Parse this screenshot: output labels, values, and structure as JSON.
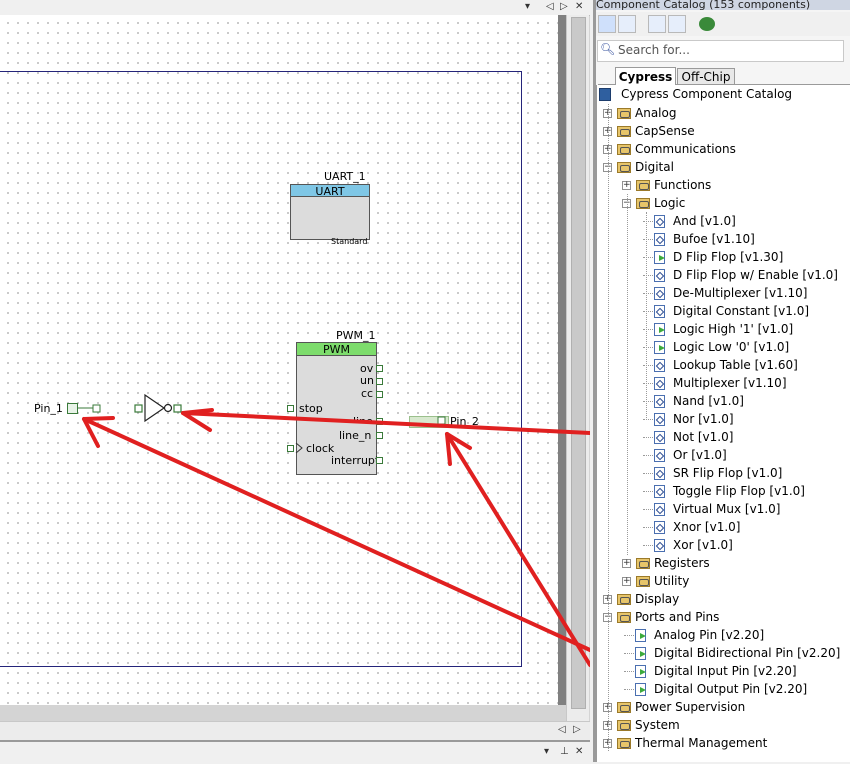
{
  "catalog": {
    "title": "Component Catalog (153 components)",
    "search_placeholder": "Search for...",
    "tabs": [
      {
        "label": "Cypress"
      },
      {
        "label": "Off-Chip"
      }
    ],
    "root_label": "Cypress Component Catalog",
    "tree": [
      {
        "label": "Analog",
        "depth": 0,
        "kind": "folder",
        "expander": "+"
      },
      {
        "label": "CapSense",
        "depth": 0,
        "kind": "folder",
        "expander": "+"
      },
      {
        "label": "Communications",
        "depth": 0,
        "kind": "folder",
        "expander": "+"
      },
      {
        "label": "Digital",
        "depth": 0,
        "kind": "folder",
        "expander": "-"
      },
      {
        "label": "Functions",
        "depth": 1,
        "kind": "folder",
        "expander": "+"
      },
      {
        "label": "Logic",
        "depth": 1,
        "kind": "folder",
        "expander": "-"
      },
      {
        "label": "And [v1.0]",
        "depth": 2,
        "kind": "leaf"
      },
      {
        "label": "Bufoe [v1.10]",
        "depth": 2,
        "kind": "leaf"
      },
      {
        "label": "D Flip Flop [v1.30]",
        "depth": 2,
        "kind": "leaf-green"
      },
      {
        "label": "D Flip Flop w/ Enable [v1.0]",
        "depth": 2,
        "kind": "leaf"
      },
      {
        "label": "De-Multiplexer [v1.10]",
        "depth": 2,
        "kind": "leaf"
      },
      {
        "label": "Digital Constant [v1.0]",
        "depth": 2,
        "kind": "leaf"
      },
      {
        "label": "Logic High '1' [v1.0]",
        "depth": 2,
        "kind": "leaf-green"
      },
      {
        "label": "Logic Low '0' [v1.0]",
        "depth": 2,
        "kind": "leaf-green"
      },
      {
        "label": "Lookup Table [v1.60]",
        "depth": 2,
        "kind": "leaf"
      },
      {
        "label": "Multiplexer [v1.10]",
        "depth": 2,
        "kind": "leaf"
      },
      {
        "label": "Nand [v1.0]",
        "depth": 2,
        "kind": "leaf"
      },
      {
        "label": "Nor [v1.0]",
        "depth": 2,
        "kind": "leaf"
      },
      {
        "label": "Not [v1.0]",
        "depth": 2,
        "kind": "leaf"
      },
      {
        "label": "Or [v1.0]",
        "depth": 2,
        "kind": "leaf"
      },
      {
        "label": "SR Flip Flop [v1.0]",
        "depth": 2,
        "kind": "leaf"
      },
      {
        "label": "Toggle Flip Flop [v1.0]",
        "depth": 2,
        "kind": "leaf"
      },
      {
        "label": "Virtual Mux [v1.0]",
        "depth": 2,
        "kind": "leaf"
      },
      {
        "label": "Xnor [v1.0]",
        "depth": 2,
        "kind": "leaf"
      },
      {
        "label": "Xor [v1.0]",
        "depth": 2,
        "kind": "leaf"
      },
      {
        "label": "Registers",
        "depth": 1,
        "kind": "folder",
        "expander": "+"
      },
      {
        "label": "Utility",
        "depth": 1,
        "kind": "folder",
        "expander": "+"
      },
      {
        "label": "Display",
        "depth": 0,
        "kind": "folder",
        "expander": "+"
      },
      {
        "label": "Ports and Pins",
        "depth": 0,
        "kind": "folder",
        "expander": "-"
      },
      {
        "label": "Analog Pin [v2.20]",
        "depth": 1,
        "kind": "leaf-green"
      },
      {
        "label": "Digital Bidirectional Pin [v2.20]",
        "depth": 1,
        "kind": "leaf-green"
      },
      {
        "label": "Digital Input Pin [v2.20]",
        "depth": 1,
        "kind": "leaf-green"
      },
      {
        "label": "Digital Output Pin [v2.20]",
        "depth": 1,
        "kind": "leaf-green"
      },
      {
        "label": "Power Supervision",
        "depth": 0,
        "kind": "folder",
        "expander": "+"
      },
      {
        "label": "System",
        "depth": 0,
        "kind": "folder",
        "expander": "+"
      },
      {
        "label": "Thermal Management",
        "depth": 0,
        "kind": "folder",
        "expander": "+"
      }
    ]
  },
  "schematic": {
    "uart": {
      "instance": "UART_1",
      "type": "UART",
      "mode": "Standard"
    },
    "pwm": {
      "instance": "PWM_1",
      "type": "PWM",
      "inputs": [
        "stop",
        "clock"
      ],
      "outputs": [
        "ov",
        "un",
        "cc",
        "line",
        "line_n",
        "interrupt"
      ]
    },
    "pin1": {
      "label": "Pin_1"
    },
    "pin2": {
      "label": "Pin_2"
    }
  },
  "colors": {
    "annotation": "#e02020",
    "uart_header": "#7fc7e6",
    "pwm_header": "#7ddc6c",
    "sheet_border": "#24247a"
  }
}
